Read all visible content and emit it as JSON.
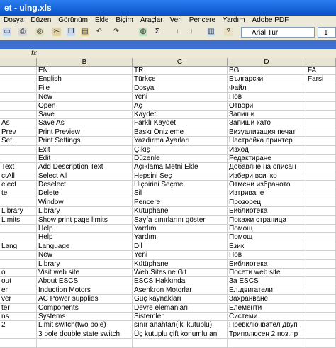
{
  "window": {
    "title": "et - ulng.xls"
  },
  "menu": [
    "Dosya",
    "Düzen",
    "Görünüm",
    "Ekle",
    "Biçim",
    "Araçlar",
    "Veri",
    "Pencere",
    "Yardım",
    "Adobe PDF"
  ],
  "toolbar": {
    "font_name": "Arial Tur",
    "font_size": "1",
    "zoom": "Σ"
  },
  "formula": {
    "fx": "fx"
  },
  "columns": [
    "B",
    "C",
    "D"
  ],
  "rows": [
    {
      "a": "",
      "b": "EN",
      "c": "TR",
      "d": "BG",
      "e": "FA"
    },
    {
      "a": "",
      "b": "English",
      "c": "Türkçe",
      "d": "Български",
      "e": "Farsi"
    },
    {
      "a": "",
      "b": "File",
      "c": "Dosya",
      "d": "Файл",
      "e": ""
    },
    {
      "a": "",
      "b": "New",
      "c": "Yeni",
      "d": "Нов",
      "e": ""
    },
    {
      "a": "",
      "b": "Open",
      "c": "Aç",
      "d": "Отвори",
      "e": ""
    },
    {
      "a": "",
      "b": "Save",
      "c": "Kaydet",
      "d": "Запиши",
      "e": ""
    },
    {
      "a": "As",
      "b": "Save As",
      "c": "Farklı Kaydet",
      "d": "Запиши като",
      "e": ""
    },
    {
      "a": "Prev",
      "b": "Print Preview",
      "c": "Baskı Önizleme",
      "d": "Визуализация печат",
      "e": ""
    },
    {
      "a": "Set",
      "b": "Print Settings",
      "c": "Yazdırma Ayarları",
      "d": "Настройка принтер",
      "e": ""
    },
    {
      "a": "",
      "b": "Exit",
      "c": "Çıkış",
      "d": "Изход",
      "e": ""
    },
    {
      "a": "",
      "b": "Edit",
      "c": "Düzenle",
      "d": "Редактиране",
      "e": ""
    },
    {
      "a": "Text",
      "b": "Add Description Text",
      "c": "Açıklama Metni Ekle",
      "d": "Добавяне на описан",
      "e": ""
    },
    {
      "a": "ctAll",
      "b": "Select All",
      "c": "Hepsini Seç",
      "d": "Избери всичко",
      "e": ""
    },
    {
      "a": "elect",
      "b": "Deselect",
      "c": "Hiçbirini Seçme",
      "d": "Отмени избраното",
      "e": ""
    },
    {
      "a": "te",
      "b": "Delete",
      "c": "Sil",
      "d": "Изтриване",
      "e": ""
    },
    {
      "a": "",
      "b": "Window",
      "c": "Pencere",
      "d": "Прозорец",
      "e": ""
    },
    {
      "a": "Library",
      "b": "Library",
      "c": "Kütüphane",
      "d": "Библиотека",
      "e": ""
    },
    {
      "a": "Limits",
      "b": "Show print page limits",
      "c": "Sayfa sınırlarını göster",
      "d": "Покажи страница",
      "e": ""
    },
    {
      "a": "",
      "b": "Help",
      "c": "Yardım",
      "d": "Помощ",
      "e": ""
    },
    {
      "a": "",
      "b": "Help",
      "c": "Yardım",
      "d": "Помощ",
      "e": ""
    },
    {
      "a": "Lang",
      "b": "Language",
      "c": "Dil",
      "d": "Език",
      "e": ""
    },
    {
      "a": "",
      "b": "New",
      "c": "Yeni",
      "d": "Нов",
      "e": ""
    },
    {
      "a": "",
      "b": "Library",
      "c": "Kütüphane",
      "d": "Библиотека",
      "e": ""
    },
    {
      "a": "o",
      "b": "Visit web site",
      "c": "Web Sitesine Git",
      "d": "Посети web site",
      "e": ""
    },
    {
      "a": "out",
      "b": "About ESCS",
      "c": "ESCS Hakkında",
      "d": "За ESCS",
      "e": ""
    },
    {
      "a": "er",
      "b": "Induction Motors",
      "c": "Asenkron Motorlar",
      "d": "Ел.двигатели",
      "e": ""
    },
    {
      "a": "ver",
      "b": "AC Power supplies",
      "c": "Güç kaynakları",
      "d": "Захранване",
      "e": ""
    },
    {
      "a": "ter",
      "b": "Components",
      "c": "Devre elemanları",
      "d": "Елементи",
      "e": ""
    },
    {
      "a": "ns",
      "b": "Systems",
      "c": "Sistemler",
      "d": "Системи",
      "e": ""
    },
    {
      "a": "2",
      "b": "Limit switch(two pole)",
      "c": "sınır anahtarı(iki kutuplu)",
      "d": "Превключвател двуп",
      "e": ""
    },
    {
      "a": "",
      "b": "3 pole double state switch",
      "c": "Üç kutuplu çift konumlu an",
      "d": "Триполюсен 2 поз.пр",
      "e": ""
    },
    {
      "a": "",
      "b": "",
      "c": "",
      "d": "",
      "e": ""
    }
  ]
}
